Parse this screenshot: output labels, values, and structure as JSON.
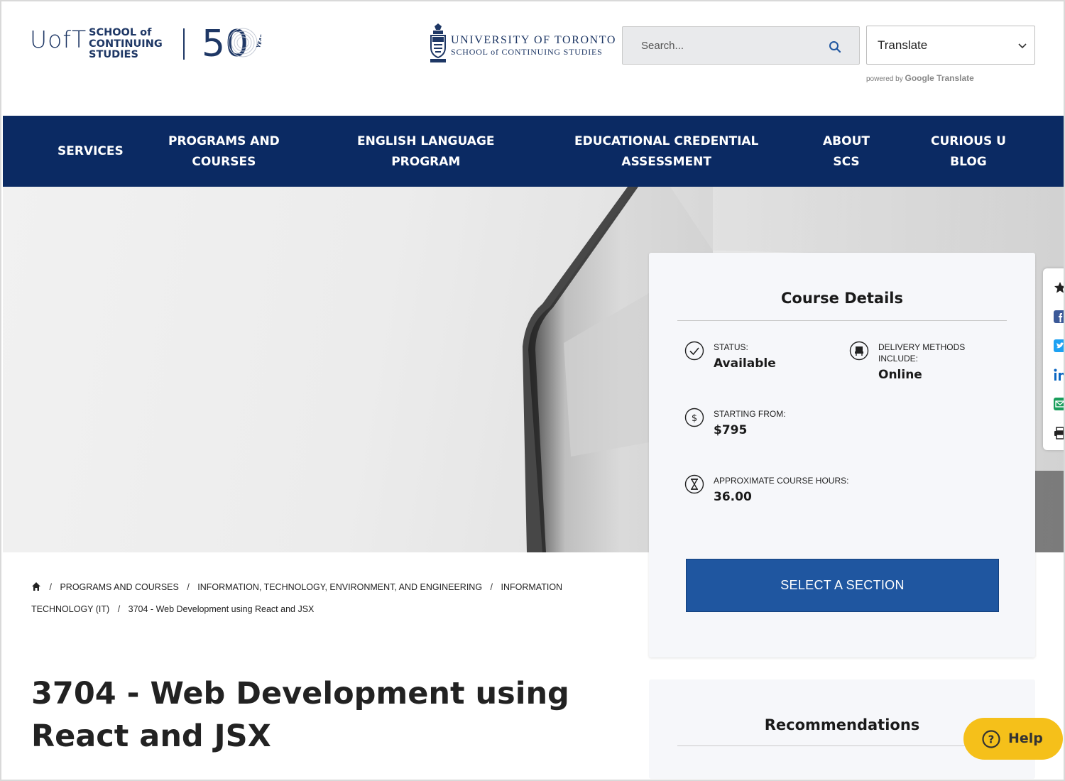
{
  "header": {
    "logo": {
      "uoft": "UofT",
      "school_lines": [
        "SCHOOL of",
        "CONTINUING",
        "STUDIES"
      ],
      "fifty": "50",
      "years": "YEARS"
    },
    "university": {
      "line1": "UNIVERSITY OF TORONTO",
      "line2": "SCHOOL of CONTINUING STUDIES"
    },
    "search": {
      "placeholder": "Search...",
      "value": ""
    },
    "translate": {
      "label": "Translate",
      "powered_by": "powered by",
      "google": "Google Translate"
    }
  },
  "nav": [
    {
      "label": "SERVICES"
    },
    {
      "label": "PROGRAMS AND\nCOURSES"
    },
    {
      "label": "ENGLISH LANGUAGE\nPROGRAM"
    },
    {
      "label": "EDUCATIONAL CREDENTIAL\nASSESSMENT"
    },
    {
      "label": "ABOUT\nSCS"
    },
    {
      "label": "CURIOUS U\nBLOG"
    }
  ],
  "course_details": {
    "title": "Course Details",
    "status": {
      "label": "STATUS:",
      "value": "Available",
      "icon": "check-circle-icon"
    },
    "delivery": {
      "label_line1": "DELIVERY METHODS",
      "label_line2": "INCLUDE:",
      "value": "Online",
      "icon": "desk-chair-icon"
    },
    "price": {
      "label": "STARTING FROM:",
      "value": "$795",
      "icon": "dollar-circle-icon"
    },
    "hours": {
      "label": "APPROXIMATE COURSE HOURS:",
      "value": "36.00",
      "icon": "hourglass-icon"
    },
    "button": "SELECT A SECTION"
  },
  "share": [
    "star-icon",
    "facebook-icon",
    "twitter-icon",
    "linkedin-icon",
    "email-icon",
    "print-icon"
  ],
  "breadcrumb": {
    "items": [
      "PROGRAMS AND COURSES",
      "INFORMATION, TECHNOLOGY, ENVIRONMENT, AND ENGINEERING",
      "INFORMATION TECHNOLOGY (IT)",
      "3704 - Web Development using React and JSX"
    ]
  },
  "page": {
    "title": "3704 - Web Development using React and JSX"
  },
  "recommendations": {
    "title": "Recommendations"
  },
  "help": {
    "label": "Help"
  },
  "colors": {
    "navy": "#0b2a63",
    "button_blue": "#1f56a0",
    "help_yellow": "#f5c01a"
  }
}
